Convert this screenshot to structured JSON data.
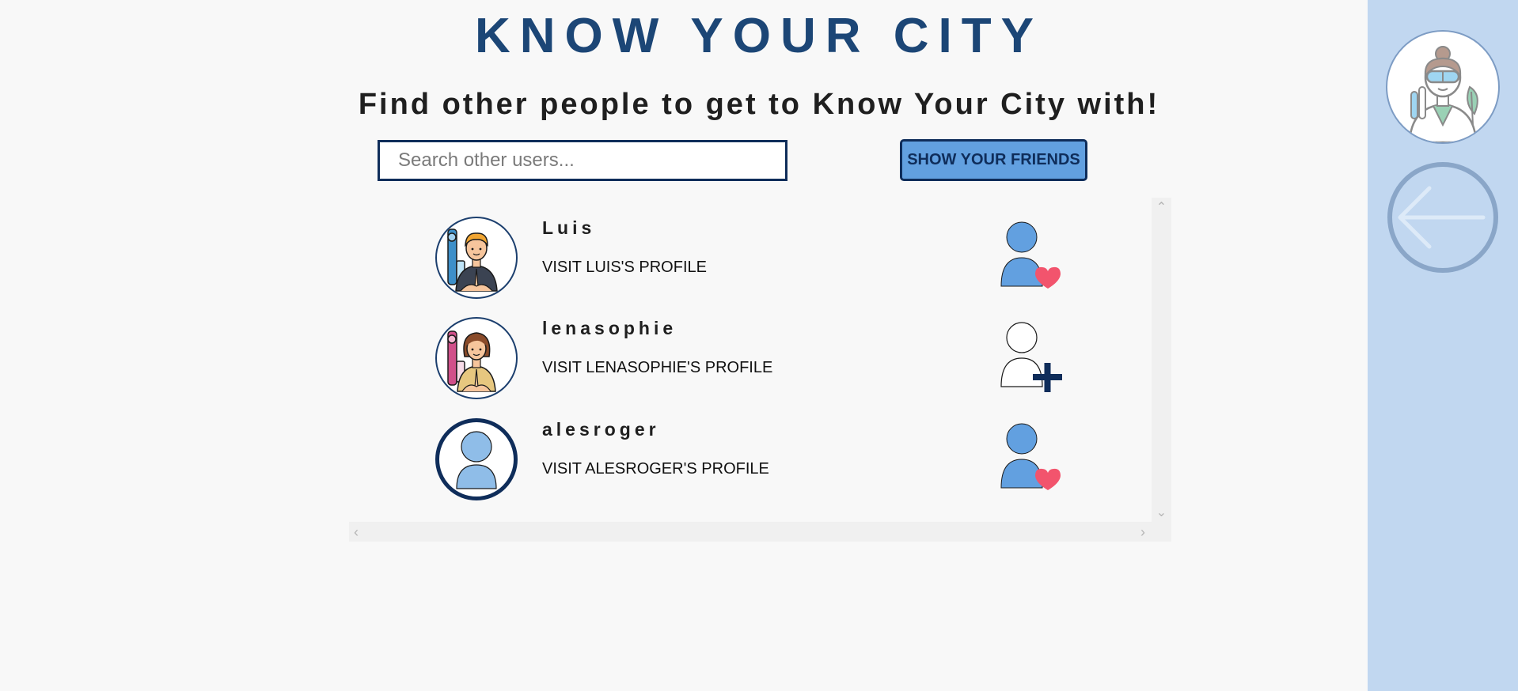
{
  "header": {
    "title": "KNOW YOUR CITY",
    "subtitle": "Find other people to get to Know Your City with!"
  },
  "search": {
    "placeholder": "Search other users...",
    "value": ""
  },
  "friends_button": {
    "label": "SHOW YOUR FRIENDS"
  },
  "users": [
    {
      "name": "Luis",
      "link": "VISIT LUIS'S PROFILE",
      "avatar": "man-yoga-avatar",
      "status": "friend",
      "status_icon": "user-heart-icon"
    },
    {
      "name": "lenasophie",
      "link": "VISIT LENASOPHIE'S PROFILE",
      "avatar": "woman-yoga-avatar",
      "status": "not-friend",
      "status_icon": "add-user-icon"
    },
    {
      "name": "alesroger",
      "link": "VISIT ALESROGER'S PROFILE",
      "avatar": "default-user-avatar",
      "status": "friend",
      "status_icon": "user-heart-icon"
    }
  ],
  "sidebar": {
    "avatar": "scientist-avatar",
    "back_icon": "back-arrow-icon"
  },
  "colors": {
    "title": "#1c4676",
    "accent_blue": "#62a0e0",
    "dark_navy": "#0f2d5a",
    "heart": "#f2546d",
    "sidebar": "#c1d7f0"
  }
}
